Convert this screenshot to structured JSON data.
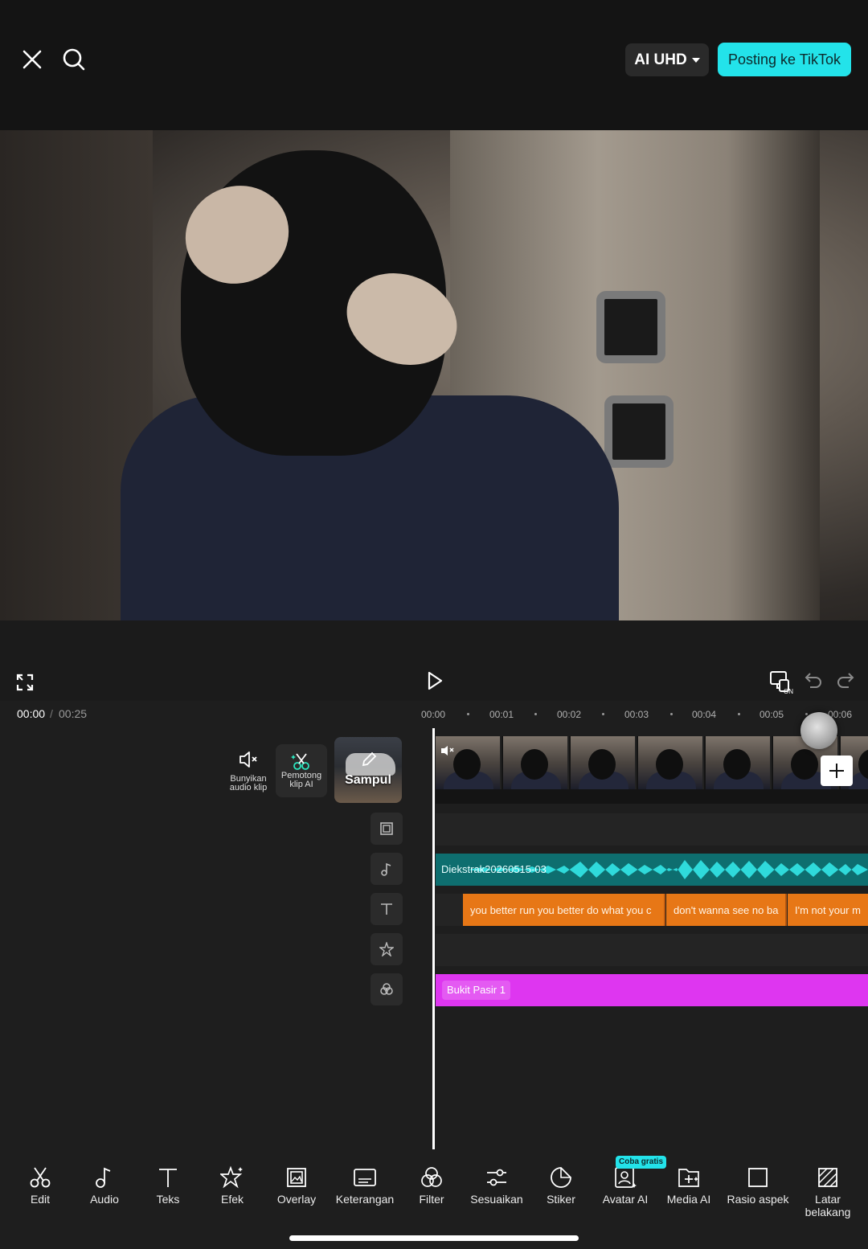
{
  "topbar": {
    "quality_label": "AI UHD",
    "post_label": "Posting ke TikTok",
    "close_icon": "close-icon",
    "search_icon": "search-icon"
  },
  "player": {
    "current_time": "00:00",
    "separator": "/",
    "total_time": "00:25"
  },
  "ruler": {
    "labels": [
      "00:00",
      "00:01",
      "00:02",
      "00:03",
      "00:04",
      "00:05",
      "00:06"
    ]
  },
  "track_tools": {
    "mute_label_1": "Bunyikan",
    "mute_label_2": "audio klip",
    "cutter_label_1": "Pemotong",
    "cutter_label_2": "klip AI",
    "cover_label": "Sampul"
  },
  "tracks": {
    "audio_name": "Diekstrak20260515-03",
    "captions": [
      "you better run you better do what you c",
      "don't wanna see no ba",
      "I'm not your m"
    ],
    "effect_name": "Bukit Pasir 1"
  },
  "toolbar": {
    "items": [
      {
        "label": "Edit",
        "icon": "scissors-icon"
      },
      {
        "label": "Audio",
        "icon": "music-note-icon"
      },
      {
        "label": "Teks",
        "icon": "text-icon"
      },
      {
        "label": "Efek",
        "icon": "sparkle-star-icon"
      },
      {
        "label": "Overlay",
        "icon": "overlay-icon"
      },
      {
        "label": "Keterangan",
        "icon": "captions-icon"
      },
      {
        "label": "Filter",
        "icon": "filter-icon"
      },
      {
        "label": "Sesuaikan",
        "icon": "sliders-icon"
      },
      {
        "label": "Stiker",
        "icon": "sticker-icon"
      },
      {
        "label": "Avatar AI",
        "icon": "avatar-ai-icon"
      },
      {
        "label": "Media AI",
        "icon": "media-ai-icon"
      },
      {
        "label": "Rasio aspek",
        "icon": "aspect-ratio-icon"
      },
      {
        "label": "Latar",
        "label2": "belakang",
        "icon": "background-icon"
      }
    ],
    "badge": "Coba gratis"
  },
  "colors": {
    "accent": "#23e3ea",
    "audio_track": "#0e6e6f",
    "caption_track": "#e77716",
    "effect_track": "#de36f0"
  }
}
